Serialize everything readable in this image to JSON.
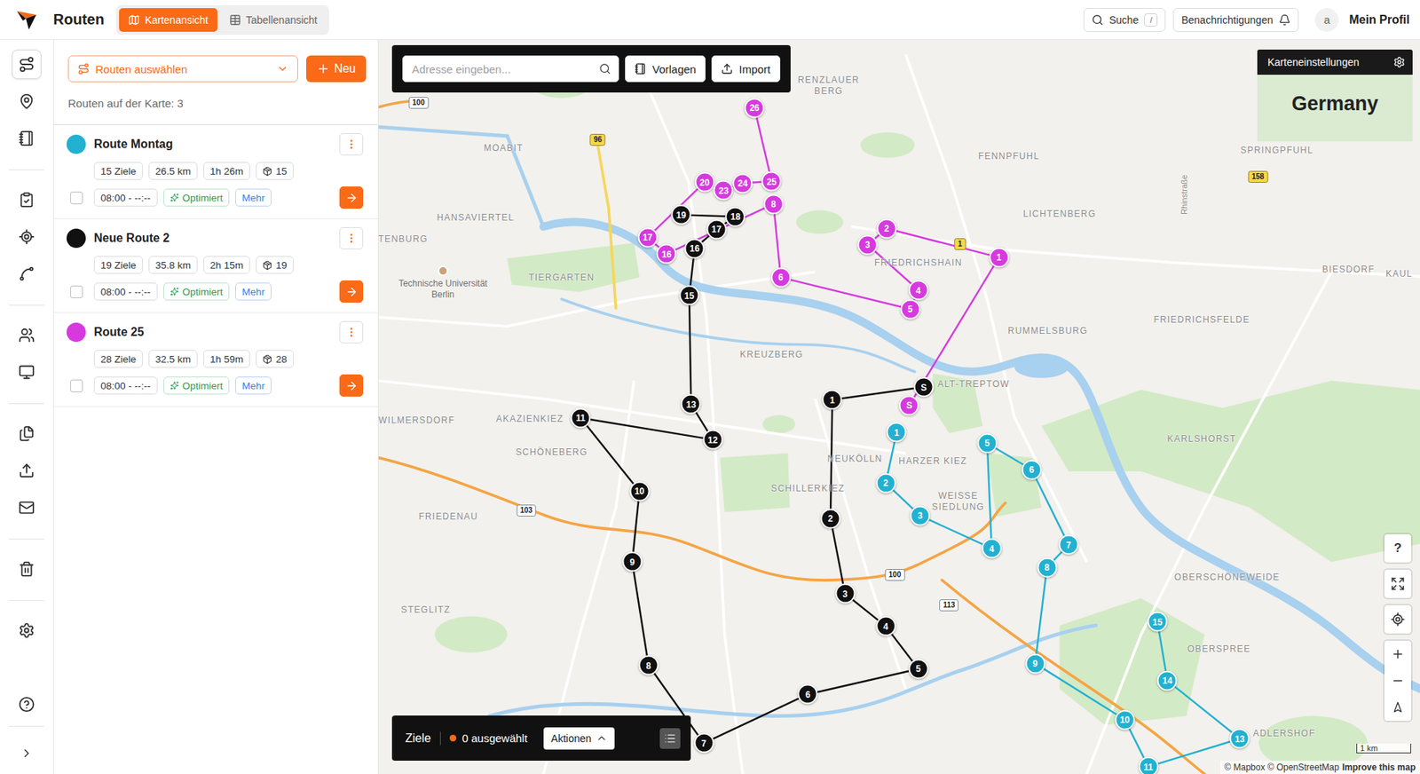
{
  "topbar": {
    "title": "Routen",
    "view_tabs": [
      {
        "label": "Kartenansicht",
        "selected": true
      },
      {
        "label": "Tabellenansicht",
        "selected": false
      }
    ],
    "search": {
      "label": "Suche",
      "shortcut": "/"
    },
    "notifications": "Benachrichtigungen",
    "profile": {
      "avatar": "a",
      "name": "Mein Profil"
    }
  },
  "sidebar": {
    "items": [
      {
        "selected": true
      },
      {
        "selected": false
      },
      {
        "selected": false
      },
      {
        "selected": false
      },
      {
        "selected": false
      },
      {
        "selected": false
      },
      {
        "selected": false
      },
      {
        "selected": false
      },
      {
        "selected": false
      },
      {
        "selected": false
      },
      {
        "selected": false
      },
      {
        "selected": false
      },
      {
        "selected": false
      },
      {
        "selected": false
      },
      {
        "selected": false
      }
    ]
  },
  "panel": {
    "select_placeholder": "Routen auswählen",
    "new_button": "Neu",
    "count": "Routen auf der Karte: 3",
    "routes": [
      {
        "name": "Route Montag",
        "color": "#22b1d1",
        "checked": false,
        "stats": [
          "15 Ziele",
          "26.5 km",
          "1h 26m"
        ],
        "packages": "15",
        "time": "08:00 - --:--",
        "status": "Optimiert",
        "more": "Mehr",
        "stops": [
          "1",
          "2",
          "3",
          "4",
          "5",
          "6",
          "7",
          "8",
          "9",
          "10",
          "11",
          "13",
          "14",
          "15"
        ]
      },
      {
        "name": "Neue Route 2",
        "color": "#111111",
        "checked": false,
        "stats": [
          "19 Ziele",
          "35.8 km",
          "2h 15m"
        ],
        "packages": "19",
        "time": "08:00 - --:--",
        "status": "Optimiert",
        "more": "Mehr",
        "stops": [
          "S",
          "1",
          "2",
          "3",
          "4",
          "5",
          "6",
          "7",
          "8",
          "9",
          "10",
          "11",
          "12",
          "13",
          "15",
          "16",
          "17",
          "18",
          "19"
        ]
      },
      {
        "name": "Route 25",
        "color": "#d63adf",
        "checked": false,
        "stats": [
          "28 Ziele",
          "32.5 km",
          "1h 59m"
        ],
        "packages": "28",
        "time": "08:00 - --:--",
        "status": "Optimiert",
        "more": "Mehr",
        "stops": [
          "S",
          "1",
          "2",
          "3",
          "4",
          "5",
          "6",
          "8",
          "16",
          "17",
          "20",
          "23",
          "24",
          "25",
          "26"
        ]
      }
    ]
  },
  "map": {
    "search": {
      "placeholder": "Adresse eingeben...",
      "templates": "Vorlagen",
      "import": "Import"
    },
    "settings": "Karteneinstellungen",
    "country": "Germany",
    "labels": [
      {
        "text": "MOABIT",
        "kind": "district"
      },
      {
        "text": "HANSAVIERTEL",
        "kind": "district"
      },
      {
        "text": "TENBURG",
        "kind": "district"
      },
      {
        "text": "TIERGARTEN",
        "kind": "district"
      },
      {
        "text": "Technische Universität Berlin",
        "kind": "poi"
      },
      {
        "text": "RENZLAUER BERG",
        "kind": "stacked"
      },
      {
        "text": "FENNPFUHL",
        "kind": "district"
      },
      {
        "text": "LICHTENBERG",
        "kind": "district"
      },
      {
        "text": "FRIEDRICHSHAIN",
        "kind": "district"
      },
      {
        "text": "RUMMELSBURG",
        "kind": "district"
      },
      {
        "text": "FRIEDRICHSFELDE",
        "kind": "district"
      },
      {
        "text": "BIESDORF",
        "kind": "district"
      },
      {
        "text": "KREUZBERG",
        "kind": "district"
      },
      {
        "text": "ALT-TREPTOW",
        "kind": "district"
      },
      {
        "text": "KARLSHORST",
        "kind": "district"
      },
      {
        "text": "NEUKÖLLN",
        "kind": "district"
      },
      {
        "text": "HARZER KIEZ",
        "kind": "district"
      },
      {
        "text": "SCHILLERKIEZ",
        "kind": "district"
      },
      {
        "text": "WEISSE SIEDLUNG",
        "kind": "stacked"
      },
      {
        "text": "WILMERSDORF",
        "kind": "district"
      },
      {
        "text": "AKAZIENKIEZ",
        "kind": "district"
      },
      {
        "text": "SCHÖNEBERG",
        "kind": "district"
      },
      {
        "text": "FRIEDENAU",
        "kind": "district"
      },
      {
        "text": "STEGLITZ",
        "kind": "district"
      },
      {
        "text": "OBERSCHÖNEWEIDE",
        "kind": "district"
      },
      {
        "text": "OBERSPREE",
        "kind": "district"
      },
      {
        "text": "ADLERSHOF",
        "kind": "district"
      },
      {
        "text": "SPRINGPFUHL",
        "kind": "district"
      },
      {
        "text": "KAUL",
        "kind": "district"
      },
      {
        "text": "Rhinstraße",
        "kind": "street"
      }
    ],
    "shields": [
      {
        "text": "100",
        "kind": "motorway"
      },
      {
        "text": "96",
        "kind": "federal"
      },
      {
        "text": "1",
        "kind": "federal"
      },
      {
        "text": "158",
        "kind": "federal"
      },
      {
        "text": "103",
        "kind": "motorway"
      },
      {
        "text": "100",
        "kind": "motorway"
      },
      {
        "text": "113",
        "kind": "motorway"
      }
    ],
    "controls": {
      "help": "?"
    },
    "scale": "1 km",
    "attribution": "© Mapbox © OpenStreetMap",
    "improve": "Improve this map",
    "bottom_bar": {
      "title": "Ziele",
      "selected_count": "0 ausgewählt",
      "actions": "Aktionen"
    }
  }
}
